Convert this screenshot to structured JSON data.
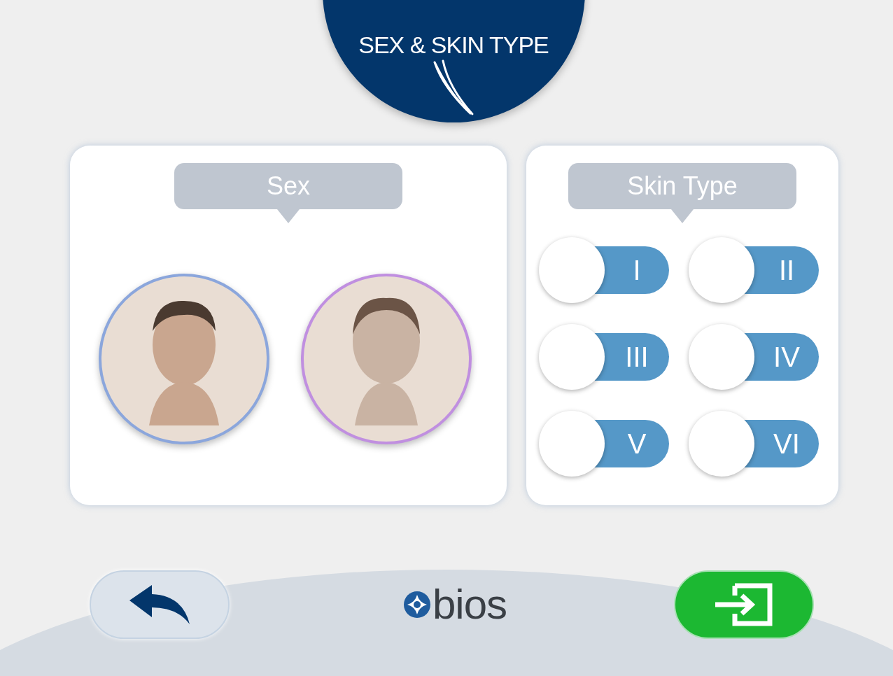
{
  "header": {
    "title": "SEX & SKIN TYPE"
  },
  "sex_panel": {
    "label": "Sex",
    "options": [
      {
        "kind": "male",
        "color": "#8ba6dc",
        "selected": false
      },
      {
        "kind": "female",
        "color": "#c08fe0",
        "selected": false
      }
    ]
  },
  "skin_panel": {
    "label": "Skin Type",
    "toggles": [
      {
        "label": "I",
        "on": false
      },
      {
        "label": "II",
        "on": false
      },
      {
        "label": "III",
        "on": false
      },
      {
        "label": "IV",
        "on": false
      },
      {
        "label": "V",
        "on": false
      },
      {
        "label": "VI",
        "on": false
      }
    ]
  },
  "footer": {
    "logo": "bios"
  }
}
